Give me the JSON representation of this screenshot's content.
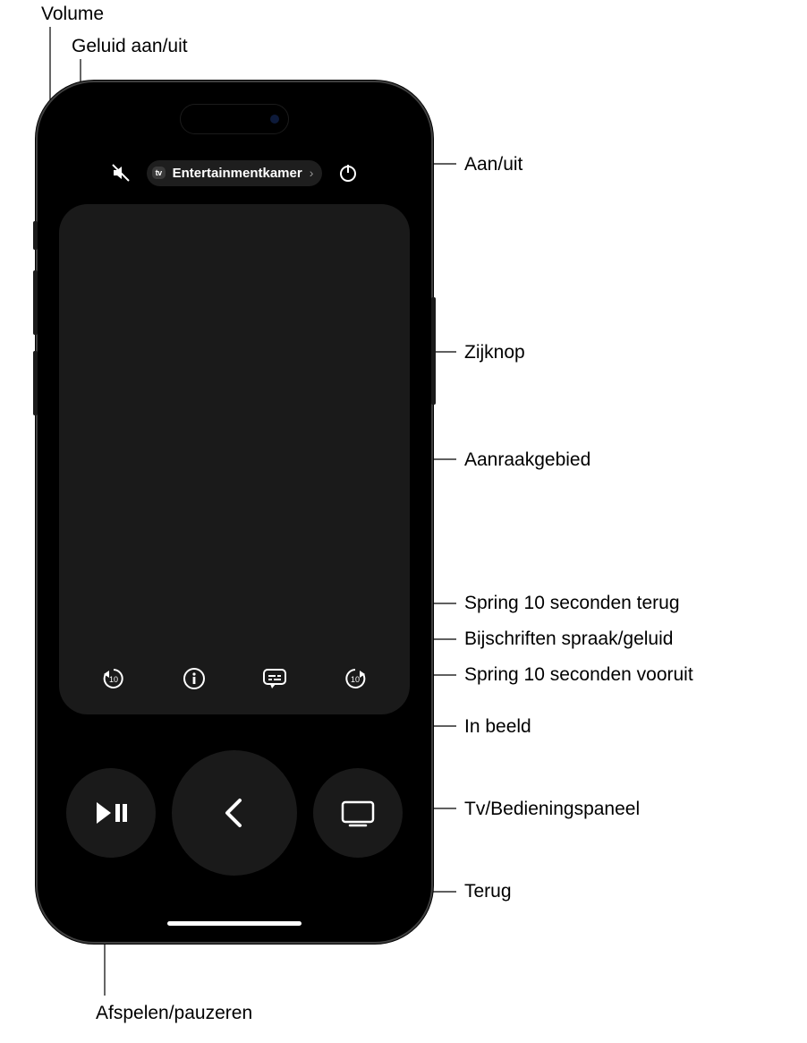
{
  "callouts": {
    "volume": "Volume",
    "mute": "Geluid aan/uit",
    "power": "Aan/uit",
    "side_button": "Zijknop",
    "touch_area": "Aanraakgebied",
    "skip_back": "Spring 10 seconden terug",
    "captions": "Bijschriften spraak/geluid",
    "skip_fwd": "Spring 10 seconden vooruit",
    "now_playing": "In beeld",
    "tv_panel": "Tv/Bedieningspaneel",
    "back": "Terug",
    "play_pause": "Afspelen/pauzeren"
  },
  "topbar": {
    "device_badge": "tv",
    "device_label": "Entertainmentkamer"
  },
  "icons": {
    "skip_back_label": "10",
    "skip_fwd_label": "10"
  }
}
